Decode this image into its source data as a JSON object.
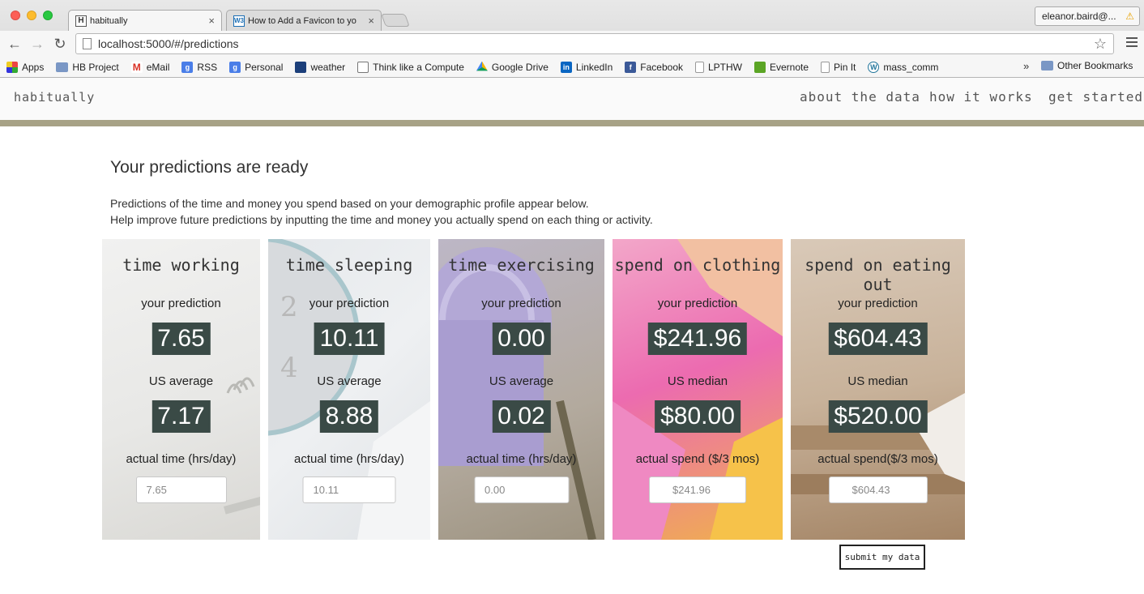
{
  "browser": {
    "tabs": [
      {
        "favicon": "H",
        "title": "habitually",
        "close": "×"
      },
      {
        "favicon": "W3",
        "title": "How to Add a Favicon to yo",
        "close": "×"
      }
    ],
    "profile": {
      "name": "eleanor.baird@...",
      "warning_icon": "⚠"
    },
    "address": "localhost:5000/#/predictions",
    "nav": {
      "back": "←",
      "forward": "→",
      "reload": "↻",
      "star": "☆"
    },
    "bookmarks": [
      {
        "label": "Apps",
        "icon": "apps-grid-icon",
        "color": "#d44"
      },
      {
        "label": "HB Project",
        "icon": "folder-icon",
        "color": "#7a97c5"
      },
      {
        "label": "eMail",
        "icon": "gmail-icon",
        "color": "#d93025"
      },
      {
        "label": "RSS",
        "icon": "google-icon",
        "color": "#4a7ee8"
      },
      {
        "label": "Personal",
        "icon": "google-icon",
        "color": "#4a7ee8"
      },
      {
        "label": "weather",
        "icon": "weather-icon",
        "color": "#1c3f7a"
      },
      {
        "label": "Think like a Compute",
        "icon": "page-icon",
        "color": "#777"
      },
      {
        "label": "Google Drive",
        "icon": "drive-icon",
        "color": "#2e9a4f"
      },
      {
        "label": "LinkedIn",
        "icon": "linkedin-icon",
        "color": "#0a66c2"
      },
      {
        "label": "Facebook",
        "icon": "facebook-icon",
        "color": "#3b5998"
      },
      {
        "label": "LPTHW",
        "icon": "page-icon",
        "color": "#999"
      },
      {
        "label": "Evernote",
        "icon": "evernote-icon",
        "color": "#5ba525"
      },
      {
        "label": "Pin It",
        "icon": "page-icon",
        "color": "#999"
      },
      {
        "label": "mass_comm",
        "icon": "wordpress-icon",
        "color": "#21759b"
      }
    ],
    "bookmarks_more": "»",
    "other_bookmarks": "Other Bookmarks"
  },
  "app": {
    "brand": "habitually",
    "nav": [
      "about the data",
      "how it works",
      "get started"
    ],
    "heading": "Your predictions are ready",
    "intro_line1": "Predictions of the time and money you spend based on your demographic profile appear below.",
    "intro_line2": "Help improve future predictions by inputting the time and money you actually spend on each thing or activity.",
    "submit_label": "submit my data",
    "accent_color": "#a7a286",
    "value_box_color": "#3a4a46"
  },
  "cards": [
    {
      "title": "time working",
      "prediction_label": "your prediction",
      "prediction": "7.65",
      "average_label": "US average",
      "average": "7.17",
      "actual_label": "actual time (hrs/day)",
      "input_placeholder": "7.65"
    },
    {
      "title": "time sleeping",
      "prediction_label": "your prediction",
      "prediction": "10.11",
      "average_label": "US average",
      "average": "8.88",
      "actual_label": "actual time (hrs/day)",
      "input_placeholder": "10.11"
    },
    {
      "title": "time exercising",
      "prediction_label": "your prediction",
      "prediction": "0.00",
      "average_label": "US average",
      "average": "0.02",
      "actual_label": "actual time (hrs/day)",
      "input_placeholder": "0.00"
    },
    {
      "title": "spend on clothing",
      "prediction_label": "your prediction",
      "prediction": "$241.96",
      "average_label": "US median",
      "average": "$80.00",
      "actual_label": "actual spend ($/3 mos)",
      "input_placeholder": "$241.96"
    },
    {
      "title": "spend on eating out",
      "prediction_label": "your prediction",
      "prediction": "$604.43",
      "average_label": "US median",
      "average": "$520.00",
      "actual_label": "actual spend($/3 mos)",
      "input_placeholder": "$604.43"
    }
  ]
}
